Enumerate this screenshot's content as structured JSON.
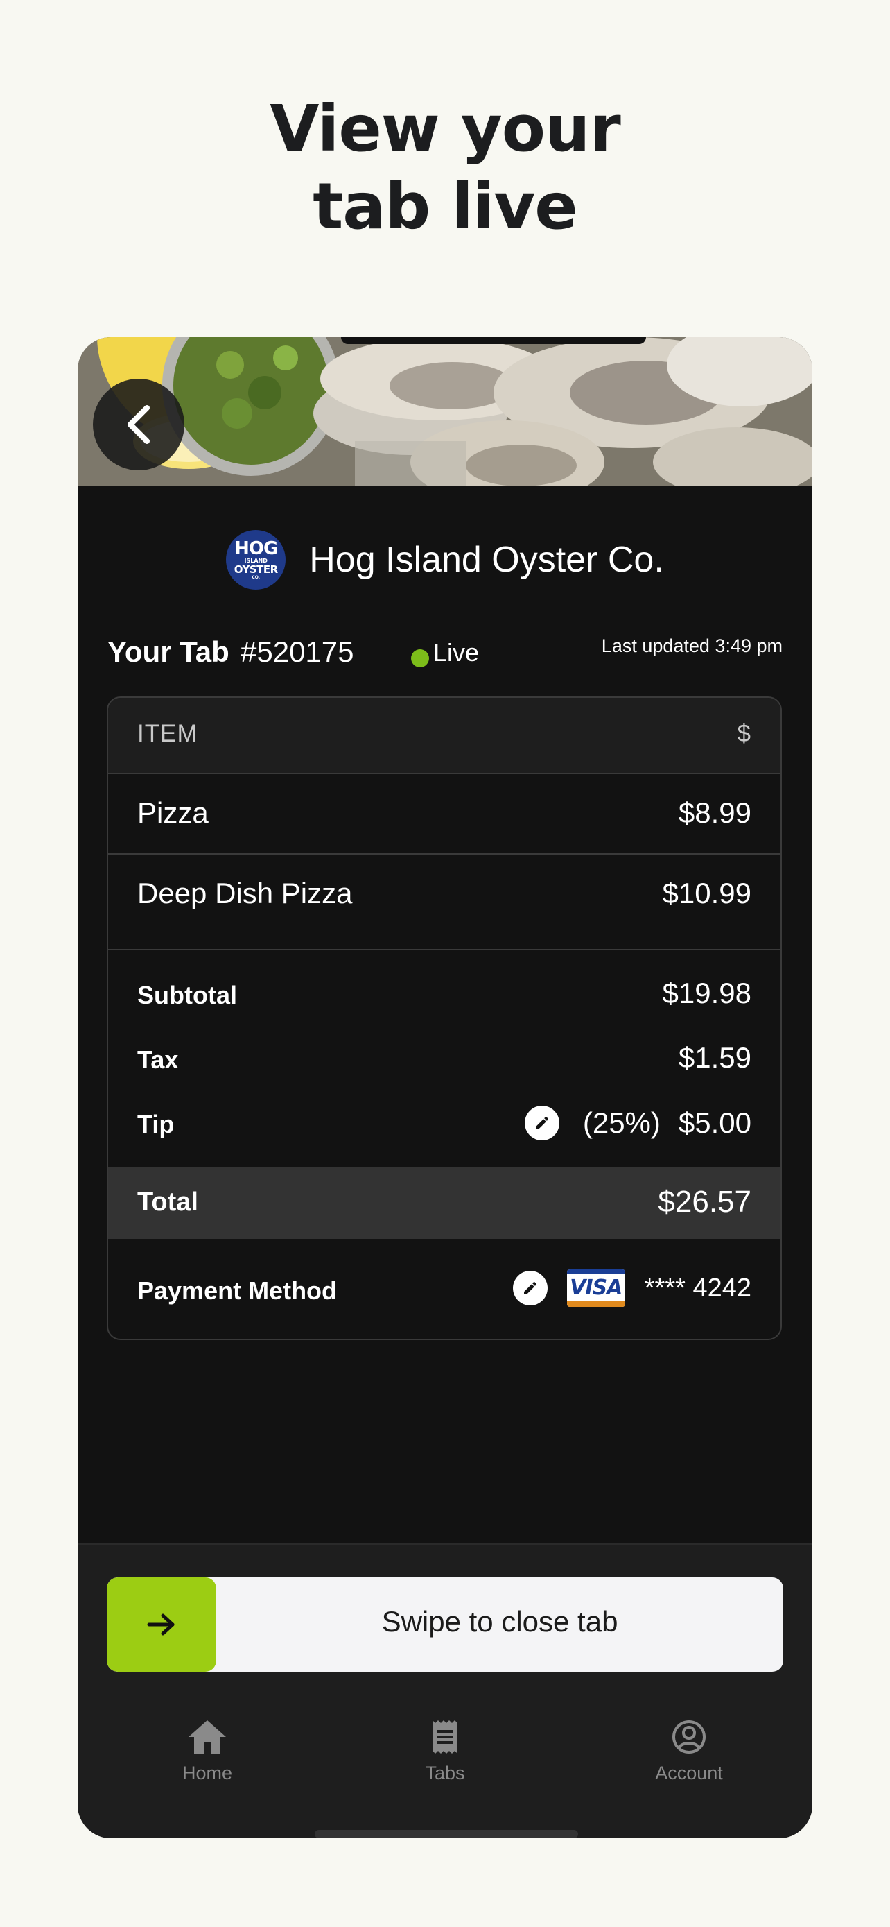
{
  "headline": {
    "line1": "View your",
    "line2": "tab live"
  },
  "merchant": {
    "logo_text": [
      "HOG",
      "ISLAND",
      "OYSTER",
      "CO."
    ],
    "name": "Hog Island Oyster Co."
  },
  "tab": {
    "label": "Your Tab",
    "number": "#520175",
    "status": "Live",
    "status_color": "#7cbc1a",
    "last_updated": "Last updated 3:49 pm"
  },
  "table": {
    "header_item": "ITEM",
    "header_amount": "$",
    "items": [
      {
        "name": "Pizza",
        "price": "$8.99"
      },
      {
        "name": "Deep Dish Pizza",
        "price": "$10.99"
      }
    ],
    "subtotal_label": "Subtotal",
    "subtotal_value": "$19.98",
    "tax_label": "Tax",
    "tax_value": "$1.59",
    "tip_label": "Tip",
    "tip_percent": "(25%)",
    "tip_value": "$5.00",
    "total_label": "Total",
    "total_value": "$26.57",
    "payment_label": "Payment Method",
    "card_brand": "VISA",
    "card_number": "**** 4242"
  },
  "swipe": {
    "label": "Swipe to close tab",
    "accent": "#9ccd13"
  },
  "nav": [
    {
      "label": "Home",
      "icon": "home-icon"
    },
    {
      "label": "Tabs",
      "icon": "receipt-icon"
    },
    {
      "label": "Account",
      "icon": "account-icon"
    }
  ]
}
